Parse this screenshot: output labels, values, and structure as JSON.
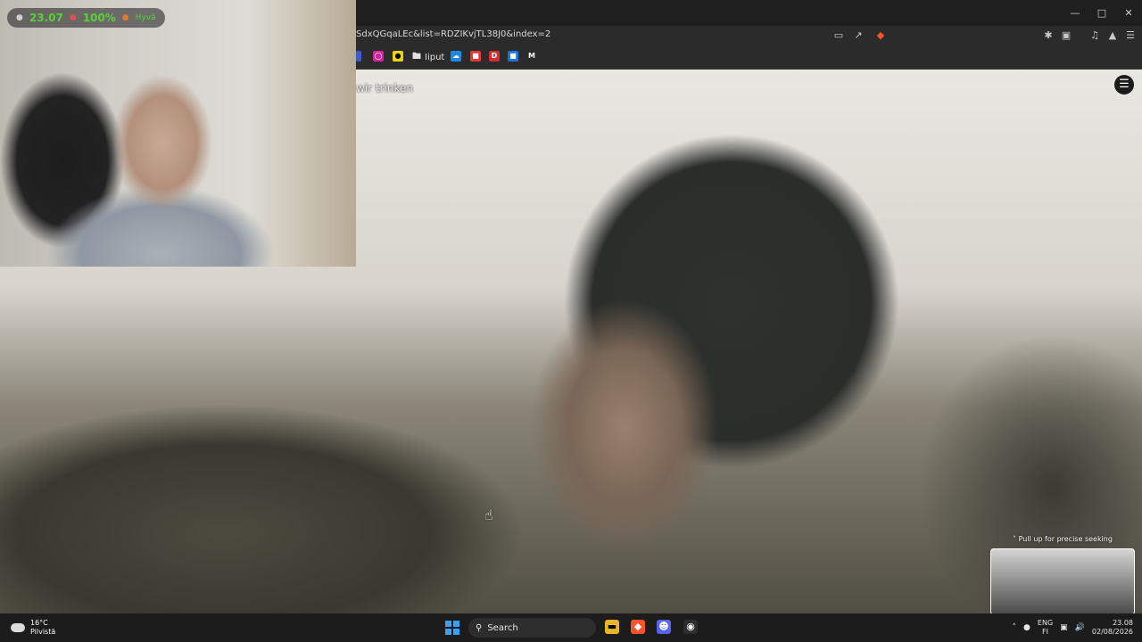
{
  "browser": {
    "url": "SdxQGqaLEc&list=RDZIKvjTL38J0&index=2",
    "window_controls": [
      "minimize",
      "maximize",
      "close"
    ],
    "bookmark_folder_label": "Iiput"
  },
  "video": {
    "subtitle": "wir trinken",
    "seek_hint": "Pull up for precise seeking"
  },
  "overlay": {
    "fps": "23.07",
    "battery": "100%",
    "signal_label": "Hyvä"
  },
  "taskbar": {
    "weather_temp": "16°C",
    "weather_desc": "Pilvistä",
    "search_label": "Search",
    "lang_top": "ENG",
    "lang_bottom": "FI",
    "time": "23.08",
    "date": "02/08/2026"
  },
  "colors": {
    "accent": "#3aa0f0",
    "overlay_green": "#59d13a"
  }
}
